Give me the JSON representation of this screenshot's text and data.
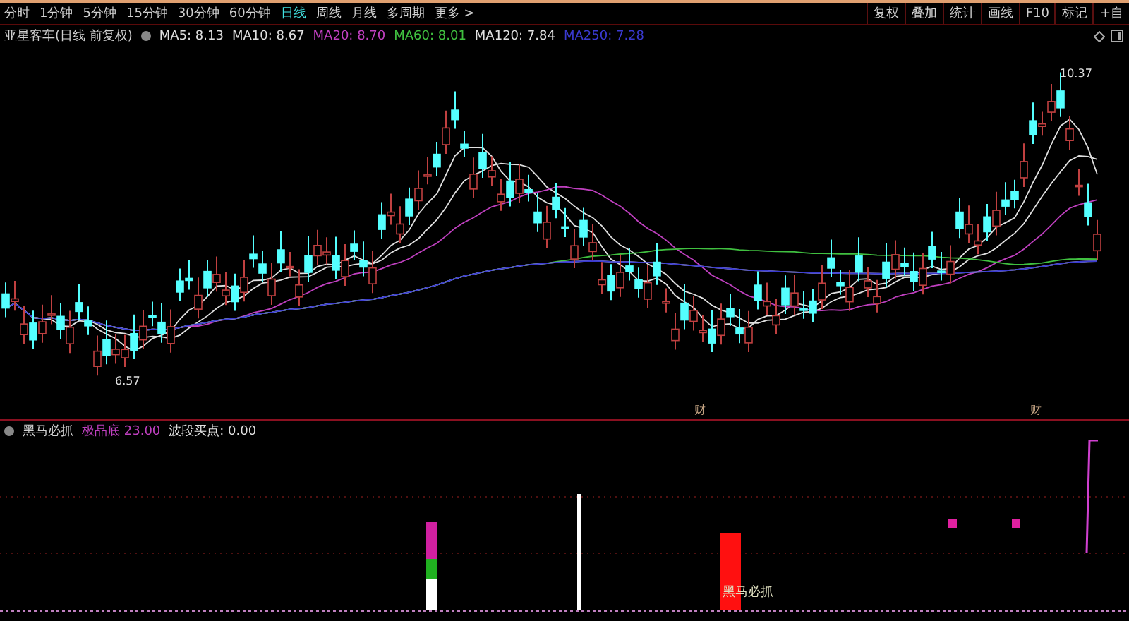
{
  "toolbar": {
    "periods": [
      {
        "label": "分时",
        "selected": false
      },
      {
        "label": "1分钟",
        "selected": false
      },
      {
        "label": "5分钟",
        "selected": false
      },
      {
        "label": "15分钟",
        "selected": false
      },
      {
        "label": "30分钟",
        "selected": false
      },
      {
        "label": "60分钟",
        "selected": false
      },
      {
        "label": "日线",
        "selected": true
      },
      {
        "label": "周线",
        "selected": false
      },
      {
        "label": "月线",
        "selected": false
      },
      {
        "label": "多周期",
        "selected": false
      },
      {
        "label": "更多 >",
        "selected": false
      }
    ],
    "buttons": [
      "复权",
      "叠加",
      "统计",
      "画线",
      "F10",
      "标记",
      "+自"
    ]
  },
  "price_panel": {
    "title": "亚星客车(日线 前复权)",
    "averages": [
      {
        "label": "MA5: 8.13",
        "color": "#e0e0e0"
      },
      {
        "label": "MA10: 8.67",
        "color": "#e0e0e0"
      },
      {
        "label": "MA20: 8.70",
        "color": "#c040c0"
      },
      {
        "label": "MA60: 8.01",
        "color": "#40c040"
      },
      {
        "label": "MA120: 7.84",
        "color": "#e0e0e0"
      },
      {
        "label": "MA250: 7.28",
        "color": "#3a3ad0"
      }
    ],
    "high_label": "10.37",
    "low_label": "6.57",
    "event_marks": [
      "财",
      "财"
    ]
  },
  "indicator_panel": {
    "name": "黑马必抓",
    "items": [
      {
        "label": "极品底",
        "value": "23.00",
        "color": "#c040c0"
      },
      {
        "label": "波段买点: 0.00",
        "color": "#e0e0e0"
      }
    ],
    "signal_label": "黑马必抓"
  }
}
